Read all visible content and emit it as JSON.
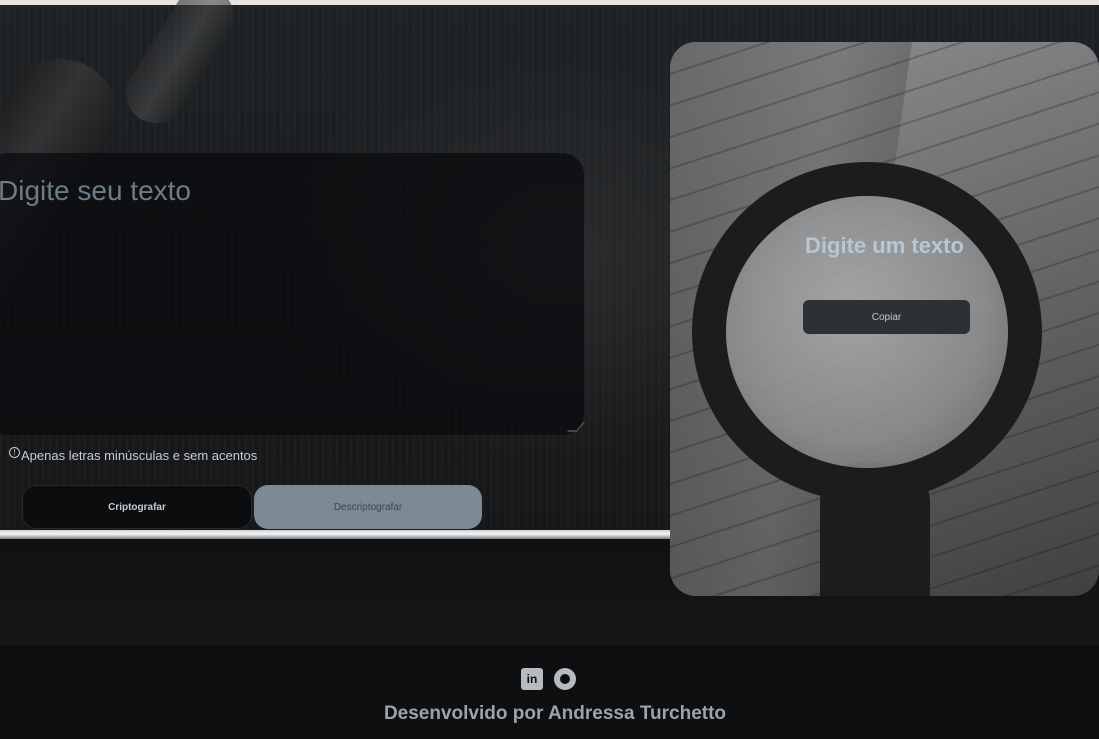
{
  "input": {
    "placeholder": "Digite seu texto",
    "hint": "Apenas letras minúsculas e sem acentos"
  },
  "actions": {
    "encrypt_label": "Criptografar",
    "decrypt_label": "Descriptografar"
  },
  "output_panel": {
    "title": "Digite um texto",
    "copy_label": "Copiar"
  },
  "footer": {
    "credit": "Desenvolvido por Andressa Turchetto",
    "icons": [
      "linkedin-icon",
      "github-icon"
    ]
  },
  "colors": {
    "decrypt_button": "#7b8a94",
    "panel_title": "#b4c8d6"
  }
}
